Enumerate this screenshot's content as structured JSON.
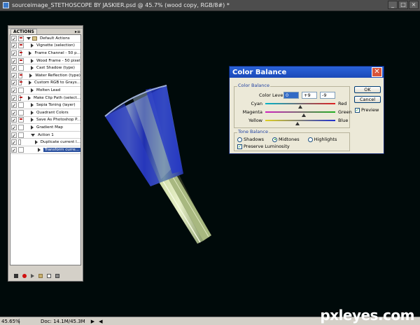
{
  "window": {
    "title": "sourceimage_STETHOSCOPE BY JASKIER.psd @ 45.7% (wood copy, RGB/8#) *",
    "buttons": [
      "_",
      "□",
      "×"
    ]
  },
  "status": {
    "zoom": "45.65%",
    "doc": "Doc: 14.1M/45.3M",
    "arrow": "▶",
    "scroll_left": "◀"
  },
  "watermark": "pxleyes.com",
  "actions_panel": {
    "tab": "ACTIONS",
    "menu_glyph": "▸≡",
    "items": [
      {
        "label": "Default Actions",
        "checked": true,
        "dialog": true,
        "level": 0,
        "type": "folder",
        "expanded": true
      },
      {
        "label": "Vignette (selection)",
        "checked": true,
        "dialog": true,
        "level": 1,
        "type": "action"
      },
      {
        "label": "Frame Channel - 50 p...",
        "checked": true,
        "dialog": true,
        "level": 1,
        "type": "action"
      },
      {
        "label": "Wood Frame - 50 pixel",
        "checked": true,
        "dialog": true,
        "level": 1,
        "type": "action"
      },
      {
        "label": "Cast Shadow (type)",
        "checked": true,
        "dialog": false,
        "level": 1,
        "type": "action"
      },
      {
        "label": "Water Reflection (type)",
        "checked": true,
        "dialog": true,
        "level": 1,
        "type": "action"
      },
      {
        "label": "Custom RGB to Grays...",
        "checked": true,
        "dialog": true,
        "level": 1,
        "type": "action"
      },
      {
        "label": "Molten Lead",
        "checked": true,
        "dialog": false,
        "level": 1,
        "type": "action"
      },
      {
        "label": "Make Clip Path (select...",
        "checked": true,
        "dialog": true,
        "level": 1,
        "type": "action"
      },
      {
        "label": "Sepia Toning (layer)",
        "checked": true,
        "dialog": false,
        "level": 1,
        "type": "action"
      },
      {
        "label": "Quadrant Colors",
        "checked": true,
        "dialog": false,
        "level": 1,
        "type": "action"
      },
      {
        "label": "Save As Photoshop P...",
        "checked": true,
        "dialog": true,
        "level": 1,
        "type": "action"
      },
      {
        "label": "Gradient Map",
        "checked": true,
        "dialog": false,
        "level": 1,
        "type": "action"
      },
      {
        "label": "Action 1",
        "checked": true,
        "dialog": false,
        "level": 1,
        "type": "action",
        "expanded": true
      },
      {
        "label": "Duplicate current l...",
        "checked": true,
        "dialog": false,
        "level": 2,
        "type": "step"
      },
      {
        "label": "Transform curre...",
        "checked": true,
        "dialog": false,
        "level": 2,
        "type": "step",
        "selected": true
      }
    ]
  },
  "dialog": {
    "title": "Color Balance",
    "close": "✕",
    "color_balance_group": "Color Balance",
    "levels_label": "Color Levels:",
    "levels": [
      "0",
      "+9",
      "-9"
    ],
    "sliders": [
      {
        "left": "Cyan",
        "right": "Red",
        "value": 0,
        "colors": [
          "#00b4c8",
          "#e02020"
        ]
      },
      {
        "left": "Magenta",
        "right": "Green",
        "value": 9,
        "colors": [
          "#d020c0",
          "#20b020"
        ]
      },
      {
        "left": "Yellow",
        "right": "Blue",
        "value": -9,
        "colors": [
          "#e0d020",
          "#2030d0"
        ]
      }
    ],
    "tone_group": "Tone Balance",
    "tones": [
      {
        "label": "Shadows",
        "selected": false
      },
      {
        "label": "Midtones",
        "selected": true
      },
      {
        "label": "Highlights",
        "selected": false
      }
    ],
    "preserve_luminosity": "Preserve Luminosity",
    "buttons": {
      "ok": "OK",
      "cancel": "Cancel"
    },
    "preview": "Preview",
    "check": "✓"
  }
}
